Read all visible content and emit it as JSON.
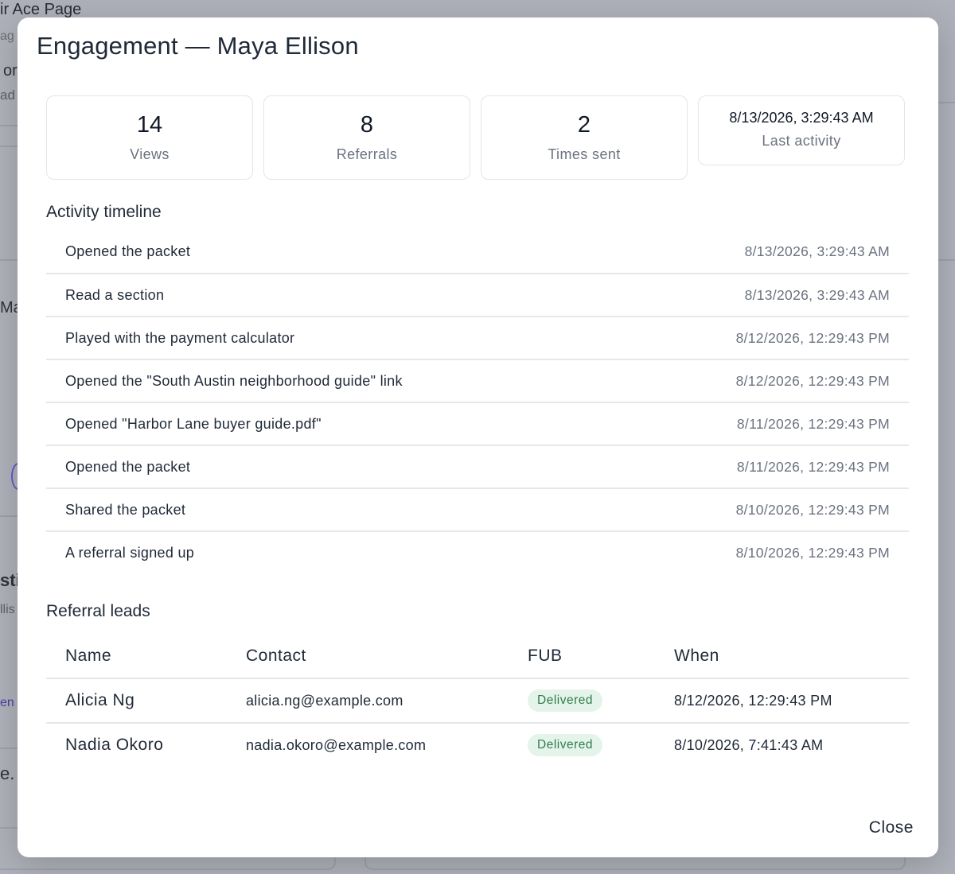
{
  "background": {
    "title": "ir Ace Page",
    "subtitle": "ag",
    "fragments": [
      "or",
      "ad",
      "Ma",
      "sti",
      "llis",
      "en",
      "e."
    ]
  },
  "modal": {
    "title": "Engagement — Maya Ellison",
    "stats": [
      {
        "value": "14",
        "label": "Views"
      },
      {
        "value": "8",
        "label": "Referrals"
      },
      {
        "value": "2",
        "label": "Times sent"
      },
      {
        "value": "8/13/2026, 3:29:43 AM",
        "label": "Last activity"
      }
    ],
    "timeline": {
      "title": "Activity timeline",
      "items": [
        {
          "text": "Opened the packet",
          "time": "8/13/2026, 3:29:43 AM"
        },
        {
          "text": "Read a section",
          "time": "8/13/2026, 3:29:43 AM"
        },
        {
          "text": "Played with the payment calculator",
          "time": "8/12/2026, 12:29:43 PM"
        },
        {
          "text": "Opened the \"South Austin neighborhood guide\" link",
          "time": "8/12/2026, 12:29:43 PM"
        },
        {
          "text": "Opened \"Harbor Lane buyer guide.pdf\"",
          "time": "8/11/2026, 12:29:43 PM"
        },
        {
          "text": "Opened the packet",
          "time": "8/11/2026, 12:29:43 PM"
        },
        {
          "text": "Shared the packet",
          "time": "8/10/2026, 12:29:43 PM"
        },
        {
          "text": "A referral signed up",
          "time": "8/10/2026, 12:29:43 PM"
        }
      ]
    },
    "leads": {
      "title": "Referral leads",
      "columns": [
        "Name",
        "Contact",
        "FUB",
        "When"
      ],
      "rows": [
        {
          "name": "Alicia Ng",
          "contact": "alicia.ng@example.com",
          "fub": "Delivered",
          "when": "8/12/2026, 12:29:43 PM"
        },
        {
          "name": "Nadia Okoro",
          "contact": "nadia.okoro@example.com",
          "fub": "Delivered",
          "when": "8/10/2026, 7:41:43 AM"
        }
      ]
    },
    "close_label": "Close"
  },
  "colors": {
    "overlay": "#aeb1b9",
    "badge_bg": "#e5f4ea",
    "badge_text": "#2f7d4a",
    "muted_text": "#6b7280"
  }
}
